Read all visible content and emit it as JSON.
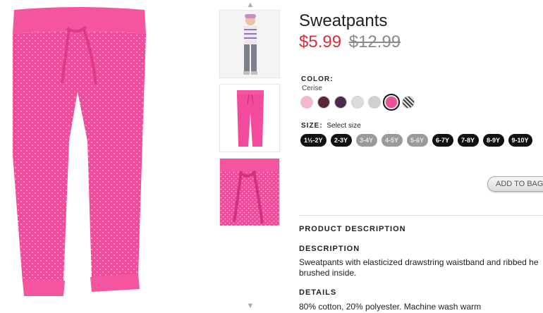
{
  "product": {
    "title": "Sweatpants",
    "price_sale": "$5.99",
    "price_original": "$12.99"
  },
  "color": {
    "label": "COLOR:",
    "selected_name": "Cerise",
    "swatches": [
      {
        "color": "#f5b6d0"
      },
      {
        "color": "#5a2637"
      },
      {
        "color": "#4a2a4e"
      },
      {
        "color": "#dcdcdc"
      },
      {
        "color": "#cfd1cf"
      },
      {
        "color": "#ee4f9a",
        "selected": true
      },
      {
        "color": "#5b5b5b",
        "pattern": "striped"
      }
    ]
  },
  "size": {
    "label": "SIZE:",
    "hint": "Select size",
    "options": [
      {
        "label": "1½-2Y",
        "available": true
      },
      {
        "label": "2-3Y",
        "available": true
      },
      {
        "label": "3-4Y",
        "available": false
      },
      {
        "label": "4-5Y",
        "available": false
      },
      {
        "label": "5-6Y",
        "available": false
      },
      {
        "label": "6-7Y",
        "available": true
      },
      {
        "label": "7-8Y",
        "available": true
      },
      {
        "label": "8-9Y",
        "available": true
      },
      {
        "label": "9-10Y",
        "available": true
      }
    ]
  },
  "actions": {
    "add_to_bag": "ADD TO BAG"
  },
  "description": {
    "heading": "PRODUCT DESCRIPTION",
    "subheading": "DESCRIPTION",
    "text": "Sweatpants with elasticized drawstring waistband and ribbed he brushed inside.",
    "details_heading": "DETAILS",
    "details_text": "80% cotton, 20% polyester. Machine wash warm"
  },
  "gallery": {
    "up_icon": "chevron-up-icon",
    "down_icon": "chevron-down-icon"
  },
  "theme": {
    "pink": "#ef4c9a",
    "sale_red": "#d32f3c"
  }
}
